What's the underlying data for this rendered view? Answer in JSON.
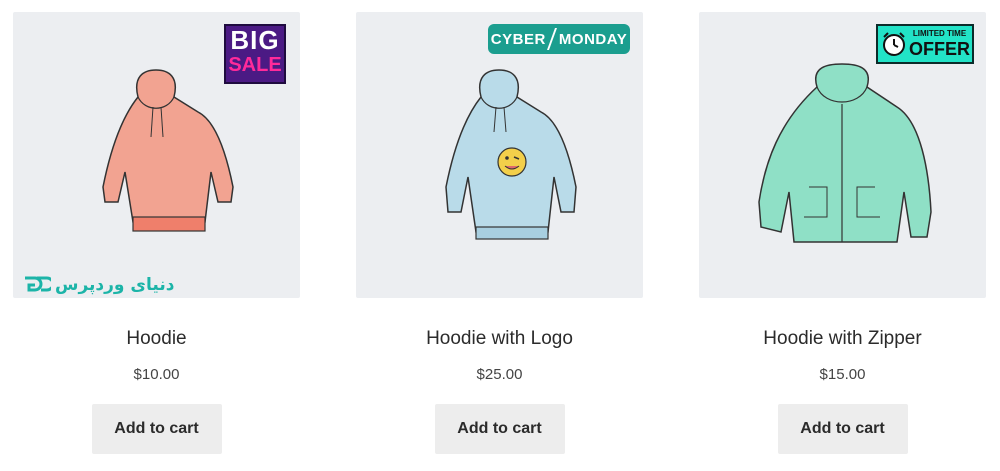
{
  "products": [
    {
      "title": "Hoodie",
      "price": "$10.00",
      "button": "Add to cart",
      "badge": {
        "line1": "BIG",
        "line2": "SALE"
      },
      "color": "#f2a391"
    },
    {
      "title": "Hoodie with Logo",
      "price": "$25.00",
      "button": "Add to cart",
      "badge": {
        "left": "CYBER",
        "right": "MONDAY"
      },
      "color": "#b9dbe9"
    },
    {
      "title": "Hoodie with Zipper",
      "price": "$15.00",
      "button": "Add to cart",
      "badge": {
        "line1": "LIMITED TIME",
        "line2": "OFFER"
      },
      "color": "#8fe0c6"
    }
  ],
  "watermark": {
    "text": "دنیای وردپرس"
  },
  "colors": {
    "thumb_bg": "#eceef1",
    "button_bg": "#ededed",
    "watermark": "#1cb4a8"
  }
}
